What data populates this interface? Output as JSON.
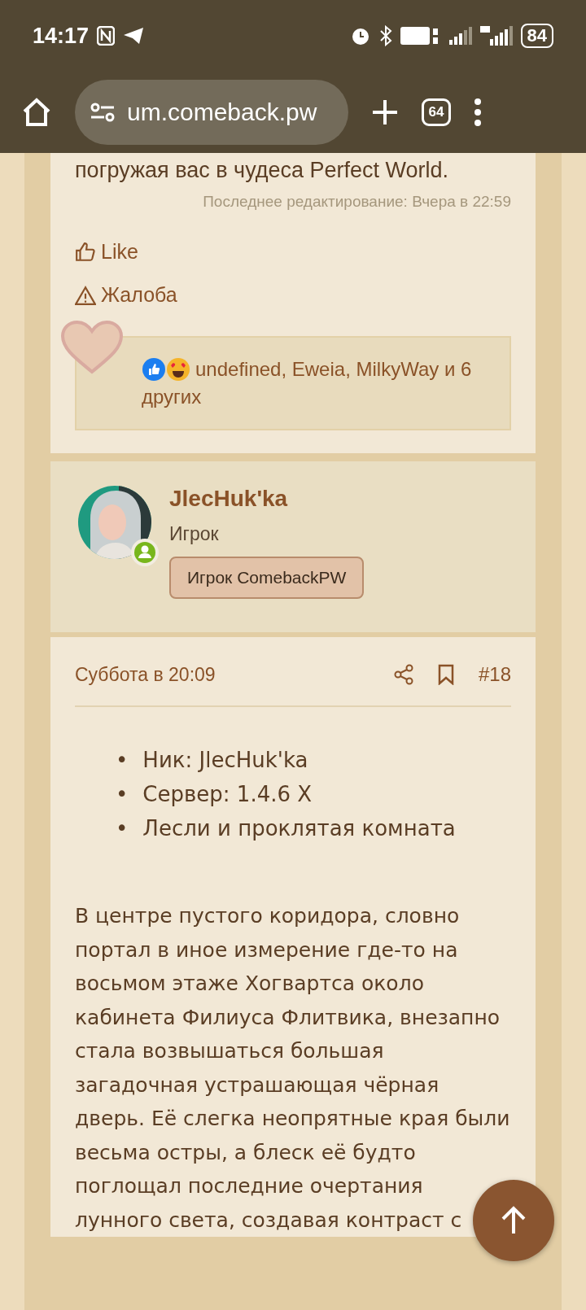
{
  "status_bar": {
    "time": "14:17",
    "battery": "84"
  },
  "browser": {
    "url": "um.comeback.pw",
    "tab_count": "64"
  },
  "previous_post": {
    "last_line": "погружая вас в чудеса Perfect World.",
    "edited": "Последнее редактирование: Вчера в 22:59",
    "actions": [
      {
        "kind": "like",
        "label": "Like"
      },
      {
        "kind": "report",
        "label": "Жалоба"
      }
    ],
    "reactions": {
      "text": "undefined, Eweia, MilkyWay и 6 других"
    }
  },
  "author": {
    "name": "JlecHuk'ka",
    "title": "Игрок",
    "badge": "Игрок ComebackPW",
    "online": true
  },
  "post": {
    "date": "Суббота в 20:09",
    "number": "#18",
    "bullet": "•",
    "list": [
      "Ник: JlecHuk'ka",
      "Сервер: 1.4.6 X",
      "Лесли и проклятая комната"
    ],
    "paragraph": "В центре пустого коридора, словно портал в иное измерение где-то на восьмом этаже Хогвартса около кабинета Филиуса Флитвика, внезапно стала возвышаться большая загадочная устрашающая чёрная дверь. Её слегка неопрятные края были весьма остры, а блеск её будто поглощал последние очертания лунного света, создавая контраст с"
  }
}
